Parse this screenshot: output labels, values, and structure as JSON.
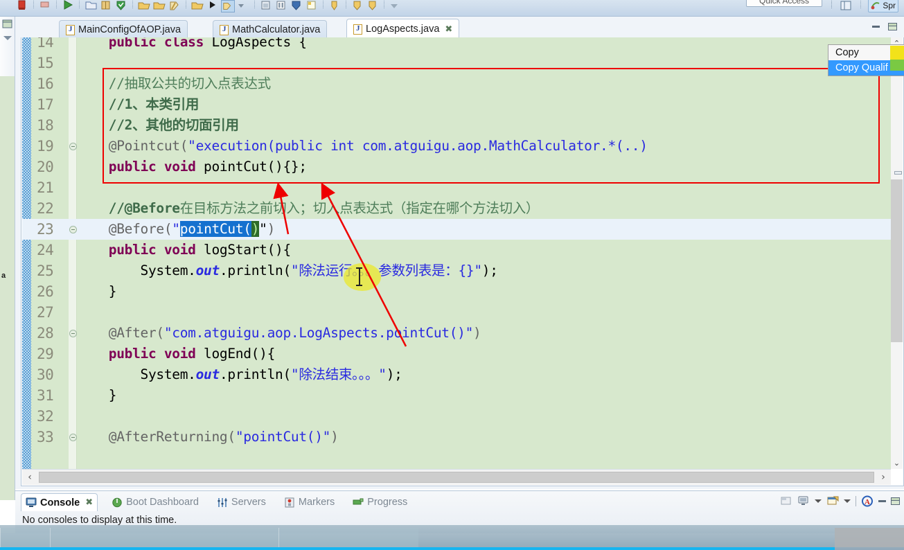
{
  "toolbar": {
    "quick_access": "Quick Access",
    "perspective": "Spr",
    "icons": [
      "stop-icon",
      "terminate-icon",
      "run-icon",
      "new-folder-icon",
      "book-icon",
      "validate-icon",
      "open-type-icon",
      "open-resource-icon",
      "search-icon",
      "folder-icon",
      "run-last-icon",
      "debug-icon",
      "profile-icon",
      "memory-icon",
      "pause-icon",
      "shield-icon",
      "note-icon",
      "previous-edit-icon",
      "back-icon",
      "forward-icon",
      "dropdown-icon"
    ]
  },
  "left_rail": {
    "restore_icon": "restore-view-icon",
    "dropdown_icon": "view-menu-icon",
    "collapse_icon": "collapse-icon",
    "letter": "a"
  },
  "editor": {
    "tabs": [
      {
        "label": "MainConfigOfAOP.java",
        "active": false,
        "closable": false
      },
      {
        "label": "MathCalculator.java",
        "active": false,
        "closable": false
      },
      {
        "label": "LogAspects.java",
        "active": true,
        "closable": true
      }
    ],
    "close_glyph": "✖",
    "window_buttons": {
      "minimize": "minimize-editor-icon",
      "maximize": "maximize-editor-icon"
    },
    "scroll": {
      "left_arrow": "‹",
      "right_arrow": "›",
      "up_arrow": "⌃",
      "down_arrow": "⌄"
    },
    "lines": [
      {
        "n": "14",
        "fold": false,
        "highlight": false,
        "partial": true,
        "tokens": [
          {
            "t": "    ",
            "c": "plain"
          },
          {
            "t": "public class ",
            "c": "kw"
          },
          {
            "t": "LogAspects",
            "c": "plain"
          },
          {
            "t": " {",
            "c": "plain"
          }
        ]
      },
      {
        "n": "15",
        "fold": false,
        "highlight": false,
        "tokens": []
      },
      {
        "n": "16",
        "fold": false,
        "highlight": false,
        "tokens": [
          {
            "t": "    ",
            "c": "plain"
          },
          {
            "t": "//抽取公共的切入点表达式",
            "c": "cmt"
          }
        ]
      },
      {
        "n": "17",
        "fold": false,
        "highlight": false,
        "tokens": [
          {
            "t": "    ",
            "c": "plain"
          },
          {
            "t": "//1、本类引用",
            "c": "cmt-b"
          }
        ]
      },
      {
        "n": "18",
        "fold": false,
        "highlight": false,
        "tokens": [
          {
            "t": "    ",
            "c": "plain"
          },
          {
            "t": "//2、其他的切面引用",
            "c": "cmt-b"
          }
        ]
      },
      {
        "n": "19",
        "fold": true,
        "highlight": false,
        "tokens": [
          {
            "t": "    ",
            "c": "plain"
          },
          {
            "t": "@Pointcut(",
            "c": "ann"
          },
          {
            "t": "\"execution(public int com.atguigu.aop.MathCalculator.*(..)",
            "c": "str"
          }
        ]
      },
      {
        "n": "20",
        "fold": false,
        "highlight": false,
        "tokens": [
          {
            "t": "    ",
            "c": "plain"
          },
          {
            "t": "public void ",
            "c": "kw"
          },
          {
            "t": "pointCut(){};",
            "c": "plain"
          }
        ]
      },
      {
        "n": "21",
        "fold": false,
        "highlight": false,
        "tokens": []
      },
      {
        "n": "22",
        "fold": false,
        "highlight": false,
        "tokens": [
          {
            "t": "    ",
            "c": "plain"
          },
          {
            "t": "//@Before",
            "c": "cmt-b"
          },
          {
            "t": "在目标方法之前切入；切入点表达式（指定在哪个方法切入）",
            "c": "cmt"
          }
        ]
      },
      {
        "n": "23",
        "fold": true,
        "highlight": true,
        "tokens": [
          {
            "t": "    ",
            "c": "plain"
          },
          {
            "t": "@Before(",
            "c": "ann"
          },
          {
            "t": "\"",
            "c": "str"
          },
          {
            "t": "pointCut(",
            "c": "sel"
          },
          {
            "t": ")",
            "c": "brk"
          },
          {
            "t": "\"",
            "c": "plain"
          },
          {
            "t": ")",
            "c": "ann"
          }
        ]
      },
      {
        "n": "24",
        "fold": false,
        "highlight": false,
        "tokens": [
          {
            "t": "    ",
            "c": "plain"
          },
          {
            "t": "public void ",
            "c": "kw"
          },
          {
            "t": "logStart(){",
            "c": "plain"
          }
        ]
      },
      {
        "n": "25",
        "fold": false,
        "highlight": false,
        "tokens": [
          {
            "t": "        System.",
            "c": "plain"
          },
          {
            "t": "out",
            "c": "fld"
          },
          {
            "t": ".println(",
            "c": "plain"
          },
          {
            "t": "\"除法运行。。。参数列表是：{}\"",
            "c": "str"
          },
          {
            "t": ");",
            "c": "plain"
          }
        ]
      },
      {
        "n": "26",
        "fold": false,
        "highlight": false,
        "tokens": [
          {
            "t": "    }",
            "c": "plain"
          }
        ]
      },
      {
        "n": "27",
        "fold": false,
        "highlight": false,
        "tokens": []
      },
      {
        "n": "28",
        "fold": true,
        "highlight": false,
        "tokens": [
          {
            "t": "    ",
            "c": "plain"
          },
          {
            "t": "@After(",
            "c": "ann"
          },
          {
            "t": "\"com.atguigu.aop.LogAspects.pointCut()\"",
            "c": "str"
          },
          {
            "t": ")",
            "c": "ann"
          }
        ]
      },
      {
        "n": "29",
        "fold": false,
        "highlight": false,
        "tokens": [
          {
            "t": "    ",
            "c": "plain"
          },
          {
            "t": "public void ",
            "c": "kw"
          },
          {
            "t": "logEnd(){",
            "c": "plain"
          }
        ]
      },
      {
        "n": "30",
        "fold": false,
        "highlight": false,
        "tokens": [
          {
            "t": "        System.",
            "c": "plain"
          },
          {
            "t": "out",
            "c": "fld"
          },
          {
            "t": ".println(",
            "c": "plain"
          },
          {
            "t": "\"除法结束。。。\"",
            "c": "str"
          },
          {
            "t": ");",
            "c": "plain"
          }
        ]
      },
      {
        "n": "31",
        "fold": false,
        "highlight": false,
        "tokens": [
          {
            "t": "    }",
            "c": "plain"
          }
        ]
      },
      {
        "n": "32",
        "fold": false,
        "highlight": false,
        "tokens": []
      },
      {
        "n": "33",
        "fold": true,
        "highlight": false,
        "tokens": [
          {
            "t": "    ",
            "c": "plain"
          },
          {
            "t": "@AfterReturning(",
            "c": "ann"
          },
          {
            "t": "\"pointCut()\"",
            "c": "str"
          },
          {
            "t": ")",
            "c": "ann"
          }
        ]
      }
    ]
  },
  "context_menu": {
    "items": [
      {
        "label": "Copy",
        "selected": false
      },
      {
        "label": "Copy Qualif",
        "selected": true
      }
    ],
    "caret": "⌃"
  },
  "console": {
    "tabs": [
      {
        "label": "Console",
        "active": true,
        "icon": "console-icon",
        "closable": true
      },
      {
        "label": "Boot Dashboard",
        "active": false,
        "icon": "boot-dashboard-icon",
        "closable": false
      },
      {
        "label": "Servers",
        "active": false,
        "icon": "servers-icon",
        "closable": false
      },
      {
        "label": "Markers",
        "active": false,
        "icon": "markers-icon",
        "closable": false
      },
      {
        "label": "Progress",
        "active": false,
        "icon": "progress-icon",
        "closable": false
      }
    ],
    "close_glyph": "✖",
    "message": "No consoles to display at this time.",
    "tools": [
      "open-console-icon",
      "display-selected-console-icon",
      "open-console-menu-icon",
      "new-console-view-icon",
      "new-console-menu-icon",
      "atguigu-icon",
      "minimize-console-icon",
      "maximize-console-icon"
    ]
  },
  "colors": {
    "editor_bg": "#d7e8cd",
    "selection": "#1571cf",
    "bracket_match": "#2e6b2a",
    "highlight_blob": "#ece826",
    "annotation_red": "#ee0000",
    "keyword": "#7f0055",
    "string": "#2a2ae0",
    "comment": "#4f7e5a",
    "current_line": "#eaf2fa"
  }
}
